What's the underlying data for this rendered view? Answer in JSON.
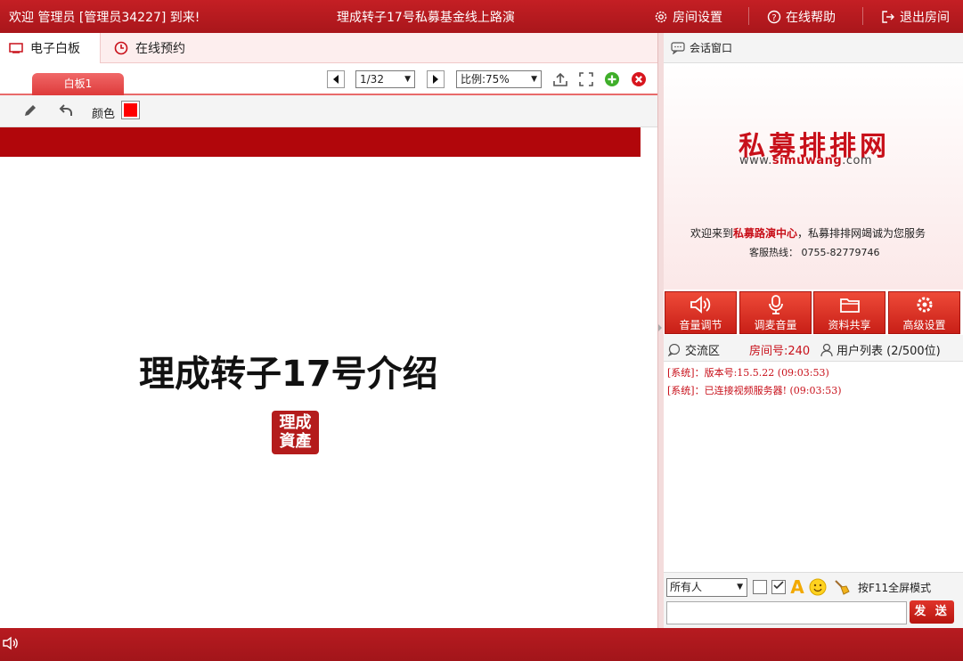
{
  "topbar": {
    "welcome": "欢迎 管理员 [管理员34227] 到来!",
    "title": "理成转子17号私募基金线上路演",
    "room_settings": "房间设置",
    "online_help": "在线帮助",
    "exit_room": "退出房间"
  },
  "tabs": [
    {
      "label": "电子白板",
      "icon": "monitor-icon"
    },
    {
      "label": "在线预约",
      "icon": "clock-icon"
    }
  ],
  "whiteboard": {
    "tab_label": "白板1",
    "page_select": "1/32",
    "zoom_select": "比例:75%",
    "color_label": "颜色",
    "current_color": "#ff0000"
  },
  "slide": {
    "title": "理成转子17号介绍",
    "logo_line1": "理成",
    "logo_line2": "資產",
    "band_color": "#b1060b"
  },
  "chat": {
    "header": "会话窗口",
    "brand": "私募排排网",
    "brand_url_prefix": "www.",
    "brand_url_bold": "simuwang",
    "brand_url_suffix": ".com",
    "welcome_prefix": "欢迎来到",
    "welcome_bold": "私募路演中心",
    "welcome_suffix": "，私募排排网竭诚为您服务",
    "hotline": "客服热线： 0755-82779746",
    "actions": [
      "音量调节",
      "调麦音量",
      "资料共享",
      "高级设置"
    ],
    "exchange_label": "交流区",
    "room_no": "房间号:240",
    "user_list": "用户列表 (2/500位)",
    "messages": [
      "[系统]：版本号:15.5.22  (09:03:53)",
      "[系统]：已连接视频服务器! (09:03:53)"
    ],
    "recipient": "所有人",
    "f11_hint": "按F11全屏模式",
    "send_label": "发 送"
  },
  "colors": {
    "primary": "#b71b20",
    "accent": "#c8101a"
  }
}
